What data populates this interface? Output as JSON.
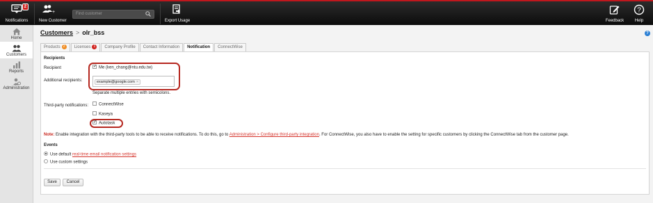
{
  "topbar": {
    "notifications_label": "Notifications",
    "notifications_badge": "2",
    "new_customer_label": "New Customer",
    "search_placeholder": "Find customer",
    "export_usage_label": "Export Usage",
    "feedback_label": "Feedback",
    "help_label": "Help"
  },
  "sidebar": {
    "items": [
      {
        "label": "Home",
        "icon": "home-icon"
      },
      {
        "label": "Customers",
        "icon": "customers-icon"
      },
      {
        "label": "Reports",
        "icon": "reports-icon"
      },
      {
        "label": "Administration",
        "icon": "administration-icon"
      }
    ]
  },
  "breadcrumb": {
    "root": "Customers",
    "separator": ">",
    "current": "olr_bss"
  },
  "help_icon_text": "?",
  "tabs": [
    {
      "label": "Products",
      "count": "2",
      "count_color": "#f08c21"
    },
    {
      "label": "Licenses",
      "count": "1",
      "count_color": "#d0211d"
    },
    {
      "label": "Company Profile"
    },
    {
      "label": "Contact Information"
    },
    {
      "label": "Notification",
      "active": true
    },
    {
      "label": "ConnectWise"
    }
  ],
  "recipients": {
    "heading": "Recipients",
    "recipient_label": "Recipient",
    "recipient_option": "Me (ken_chang@ntu.edu.tw)",
    "recipient_checked": true,
    "additional_label": "Additional recipients:",
    "additional_value": "example@google.com",
    "hint": "Separate multiple entries with semicolons."
  },
  "third_party": {
    "label": "Third-party notifications:",
    "options": [
      {
        "label": "ConnectWise",
        "checked": false
      },
      {
        "label": "Kaseya",
        "checked": false
      },
      {
        "label": "Autotask",
        "checked": true
      }
    ]
  },
  "note": {
    "prefix": "Note:",
    "text1": "Enable integration with the third-party tools to be able to receive notifications. To do this, go to",
    "link": "Administration > Configure third-party integration",
    "text2": ". For ConnectWise, you also have to enable the setting for specific customers by clicking the ConnectWise tab from the customer page."
  },
  "events": {
    "heading": "Events",
    "option1_prefix": "Use default",
    "option1_link": "real-time email notification settings",
    "option2": "Use custom settings",
    "selected": "default"
  },
  "buttons": {
    "save": "Save",
    "cancel": "Cancel"
  },
  "colors": {
    "accent_red": "#c0171d",
    "highlight_ring": "#b5261e",
    "link_red": "#d5332b"
  }
}
